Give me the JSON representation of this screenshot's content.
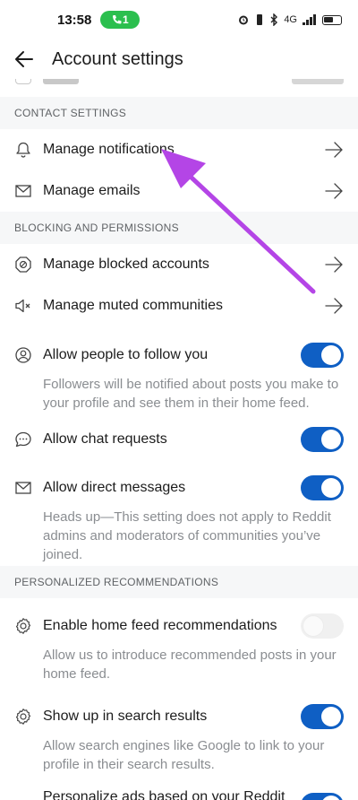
{
  "status_bar": {
    "time": "13:58",
    "call_indicator": "1",
    "icons": [
      "alarm-icon",
      "vibrate-icon",
      "bluetooth-icon",
      "volte-icon",
      "signal-icon",
      "wifi-icon",
      "battery-icon"
    ],
    "network_text": "4G"
  },
  "header": {
    "title": "Account settings",
    "back_icon": "arrow-left-icon"
  },
  "sections": {
    "contact": {
      "title": "CONTACT SETTINGS"
    },
    "blocking": {
      "title": "BLOCKING AND PERMISSIONS"
    },
    "personalized": {
      "title": "PERSONALIZED RECOMMENDATIONS"
    }
  },
  "rows": {
    "manage_notifications": {
      "label": "Manage notifications",
      "icon": "bell-icon"
    },
    "manage_emails": {
      "label": "Manage emails",
      "icon": "envelope-icon"
    },
    "manage_blocked": {
      "label": "Manage blocked accounts",
      "icon": "blocked-icon"
    },
    "manage_muted": {
      "label": "Manage muted communities",
      "icon": "muted-speaker-icon"
    },
    "allow_follow": {
      "label": "Allow people to follow you",
      "icon": "user-circle-icon",
      "enabled": true,
      "description": "Followers will be notified about posts you make to your profile and see them in their home feed."
    },
    "allow_chat": {
      "label": "Allow chat requests",
      "icon": "chat-bubble-icon",
      "enabled": true
    },
    "allow_dm": {
      "label": "Allow direct messages",
      "icon": "envelope-icon",
      "enabled": true,
      "description": "Heads up—This setting does not apply to Reddit admins and moderators of communities you’ve joined."
    },
    "home_feed_recs": {
      "label": "Enable home feed recommendations",
      "icon": "gear-icon",
      "enabled": false,
      "description": "Allow us to introduce recommended posts in your home feed."
    },
    "search_results": {
      "label": "Show up in search results",
      "icon": "gear-icon",
      "enabled": true,
      "description": "Allow search engines like Google to link to your profile in their search results."
    },
    "personalize_ads": {
      "label": "Personalize ads based on your Reddit",
      "icon": "gear-icon",
      "enabled": true
    }
  },
  "colors": {
    "toggle_on": "#0f5fc4",
    "section_bg": "#f6f7f8",
    "annotation_arrow": "#b445e6"
  }
}
